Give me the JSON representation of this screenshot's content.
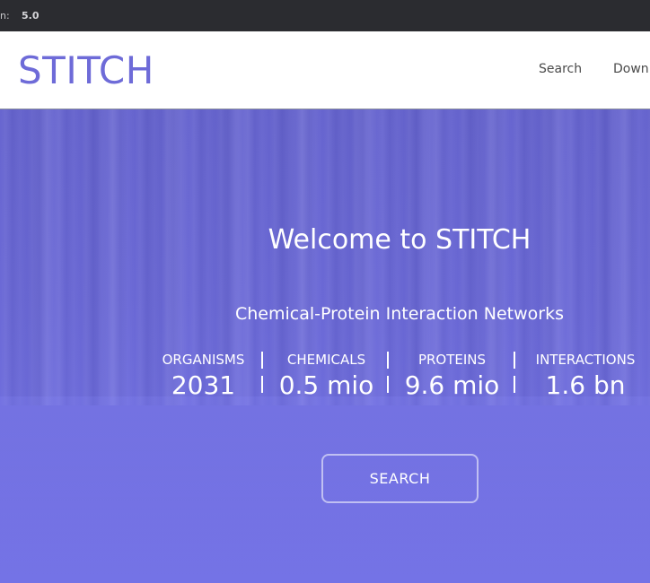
{
  "topbar": {
    "prefix": "n:",
    "version": "5.0"
  },
  "header": {
    "logo": "STITCH",
    "nav": {
      "search": "Search",
      "download": "Down"
    }
  },
  "hero": {
    "welcome": "Welcome to STITCH",
    "subtitle": "Chemical-Protein Interaction Networks",
    "stats": {
      "organisms": {
        "label": "ORGANISMS",
        "value": "2031"
      },
      "chemicals": {
        "label": "CHEMICALS",
        "value": "0.5 mio"
      },
      "proteins": {
        "label": "PROTEINS",
        "value": "9.6 mio"
      },
      "interactions": {
        "label": "INTERACTIONS",
        "value": "1.6 bn"
      }
    },
    "search_button": "SEARCH"
  },
  "colors": {
    "brand": "#6e6bd8",
    "topbar": "#2b2c30",
    "hero": "#6b69d6"
  }
}
